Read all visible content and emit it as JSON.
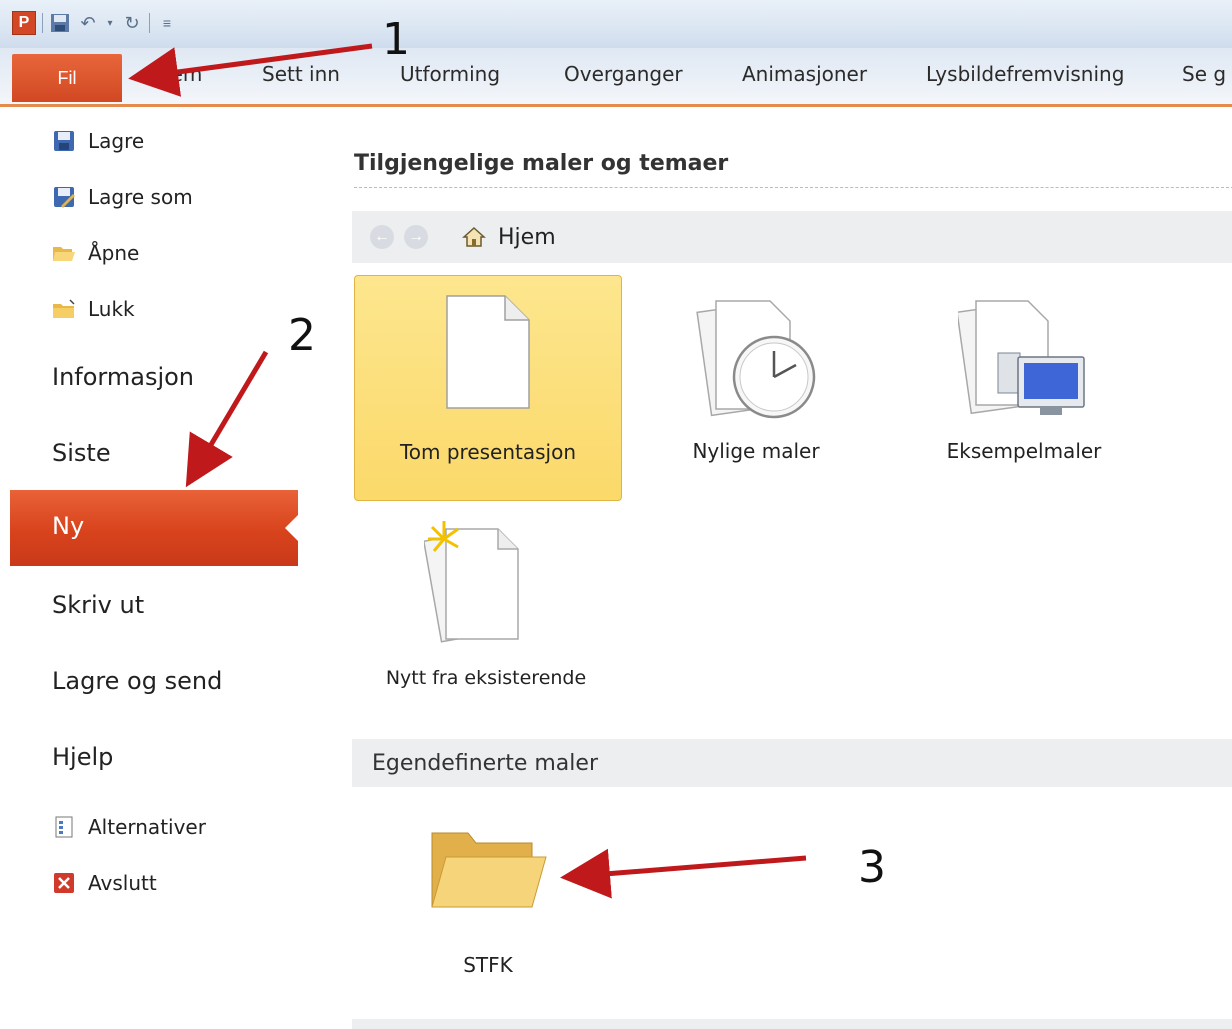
{
  "quick_access": {
    "app_icon_letter": "P",
    "icons": [
      "save-icon",
      "undo-icon",
      "redo-icon",
      "customize-icon"
    ]
  },
  "ribbon": {
    "tabs": [
      "Fil",
      "Hjem",
      "Sett inn",
      "Utforming",
      "Overganger",
      "Animasjoner",
      "Lysbildefremvisning",
      "Se g"
    ]
  },
  "backstage_nav": {
    "small_items": [
      {
        "label": "Lagre",
        "icon": "save-icon"
      },
      {
        "label": "Lagre som",
        "icon": "save-as-icon"
      },
      {
        "label": "Åpne",
        "icon": "open-folder-icon"
      },
      {
        "label": "Lukk",
        "icon": "close-folder-icon"
      }
    ],
    "big_items": [
      "Informasjon",
      "Siste",
      "Ny",
      "Skriv ut",
      "Lagre og send",
      "Hjelp"
    ],
    "selected": "Ny",
    "bottom_items": [
      {
        "label": "Alternativer",
        "icon": "options-icon"
      },
      {
        "label": "Avslutt",
        "icon": "exit-icon"
      }
    ]
  },
  "main": {
    "section_title": "Tilgjengelige maler og temaer",
    "nav_location": "Hjem",
    "templates": [
      {
        "label": "Tom presentasjon",
        "icon": "blank-page-icon",
        "selected": true
      },
      {
        "label": "Nylige maler",
        "icon": "recent-templates-icon",
        "selected": false
      },
      {
        "label": "Eksempelmaler",
        "icon": "sample-templates-icon",
        "selected": false
      },
      {
        "label": "Nytt fra eksisterende",
        "icon": "new-from-existing-icon",
        "selected": false
      }
    ],
    "custom_section_title": "Egendefinerte maler",
    "custom_folders": [
      {
        "label": "STFK",
        "icon": "folder-icon"
      }
    ]
  },
  "annotations": [
    "1",
    "2",
    "3"
  ],
  "colors": {
    "accent": "#d14822",
    "selected_tile": "#fbd96a",
    "arrow": "#c0191c"
  }
}
